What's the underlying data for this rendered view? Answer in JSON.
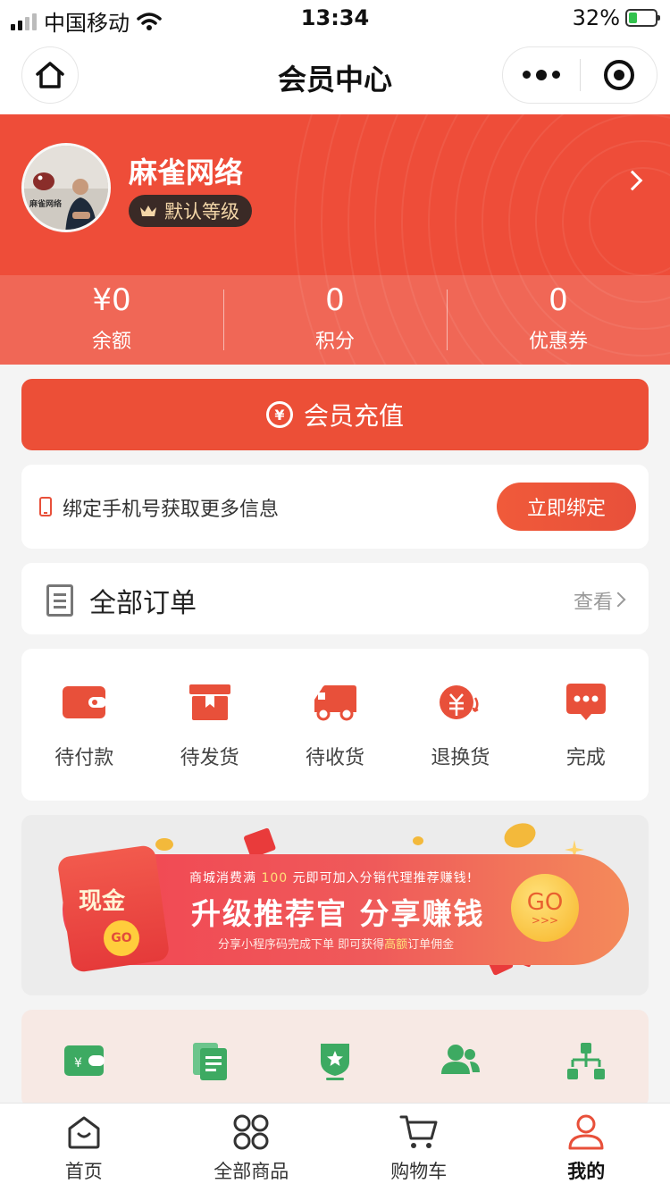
{
  "status_bar": {
    "carrier": "中国移动",
    "time": "13:34",
    "battery": "32%",
    "battery_level": 0.32
  },
  "nav": {
    "title": "会员中心"
  },
  "profile": {
    "name": "麻雀网络",
    "level": "默认等级",
    "avatar_caption": "麻雀网络"
  },
  "stats": [
    {
      "value": "¥0",
      "label": "余额"
    },
    {
      "value": "0",
      "label": "积分"
    },
    {
      "value": "0",
      "label": "优惠券"
    }
  ],
  "recharge": {
    "label": "会员充值"
  },
  "bind": {
    "text": "绑定手机号获取更多信息",
    "button": "立即绑定"
  },
  "orders": {
    "title": "全部订单",
    "view": "查看",
    "items": [
      {
        "label": "待付款",
        "icon": "wallet-icon"
      },
      {
        "label": "待发货",
        "icon": "box-icon"
      },
      {
        "label": "待收货",
        "icon": "truck-icon"
      },
      {
        "label": "退换货",
        "icon": "refund-icon"
      },
      {
        "label": "完成",
        "icon": "chat-bubble-icon"
      }
    ]
  },
  "promo": {
    "cash": "现金",
    "go_small": "GO",
    "line1_a": "商城消费满",
    "line1_amount": "100",
    "line1_b": "元即可加入分销代理推荐赚钱!",
    "main": "升级推荐官 分享赚钱",
    "line3_a": "分享小程序码完成下单 即可获得",
    "line3_hl": "高额",
    "line3_b": "订单佣金",
    "go": "GO",
    "go_arrows": ">>>"
  },
  "tools": [
    {
      "icon": "green-wallet-icon"
    },
    {
      "icon": "green-documents-icon"
    },
    {
      "icon": "green-badge-icon"
    },
    {
      "icon": "green-users-icon"
    },
    {
      "icon": "green-org-chart-icon"
    }
  ],
  "tabbar": {
    "items": [
      {
        "label": "首页",
        "icon": "home-bag-icon"
      },
      {
        "label": "全部商品",
        "icon": "grid-icon"
      },
      {
        "label": "购物车",
        "icon": "cart-icon"
      },
      {
        "label": "我的",
        "icon": "user-icon"
      }
    ],
    "active_index": 3
  },
  "colors": {
    "brand": "#ee4d39",
    "green": "#3daa62",
    "active_tab": "#e8503a"
  }
}
